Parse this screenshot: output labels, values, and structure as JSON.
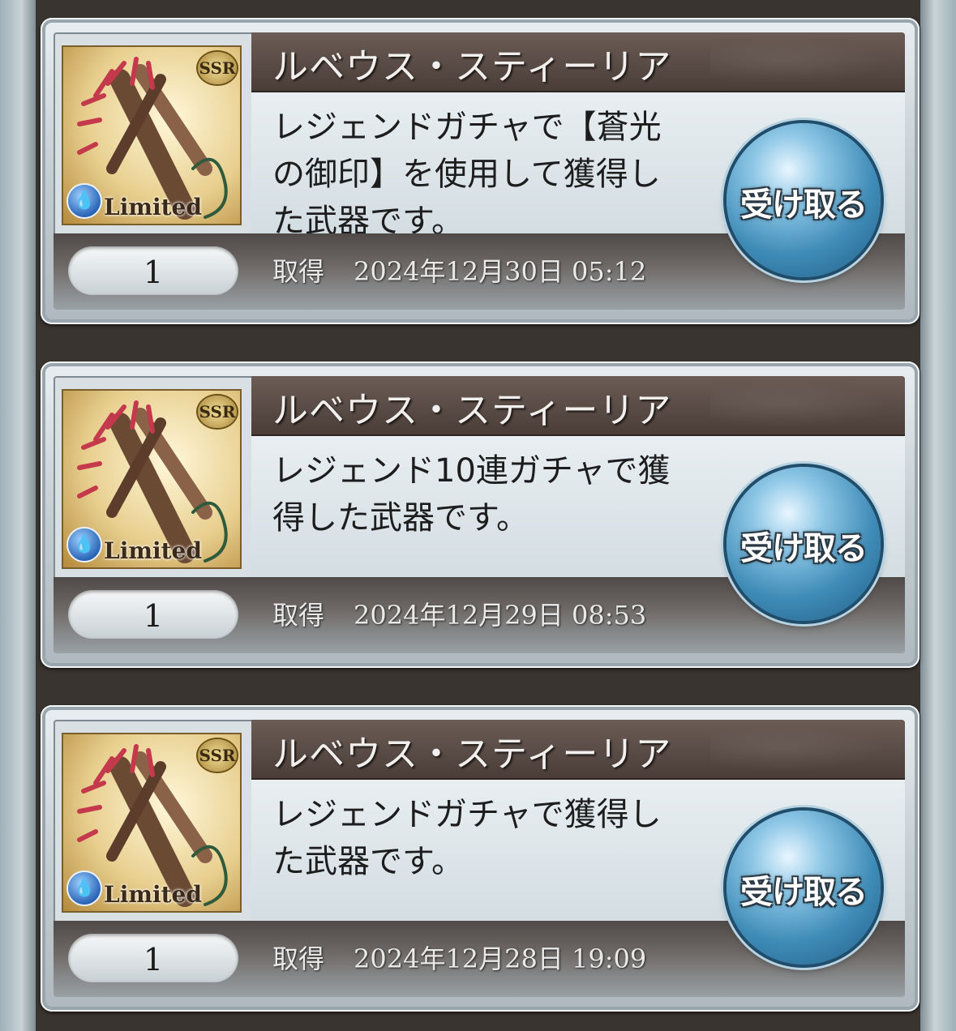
{
  "items": [
    {
      "name": "ルベウス・スティーリア",
      "rarity": "SSR",
      "tag": "Limited",
      "description": "レジェンドガチャで【蒼光\nの御印】を使用して獲得し\nた武器です。",
      "quantity": "1",
      "acquired_label": "取得",
      "acquired_date": "2024年12月30日 05:12",
      "button_label": "受け取る"
    },
    {
      "name": "ルベウス・スティーリア",
      "rarity": "SSR",
      "tag": "Limited",
      "description": "レジェンド10連ガチャで獲\n得した武器です。",
      "quantity": "1",
      "acquired_label": "取得",
      "acquired_date": "2024年12月29日 08:53",
      "button_label": "受け取る"
    },
    {
      "name": "ルベウス・スティーリア",
      "rarity": "SSR",
      "tag": "Limited",
      "description": "レジェンドガチャで獲得し\nた武器です。",
      "quantity": "1",
      "acquired_label": "取得",
      "acquired_date": "2024年12月28日 19:09",
      "button_label": "受け取る"
    }
  ],
  "element_icon": "water-element-icon",
  "colors": {
    "title_bar": "#4a3d38",
    "button": "#3f8cb8",
    "background": "#3a3430"
  }
}
